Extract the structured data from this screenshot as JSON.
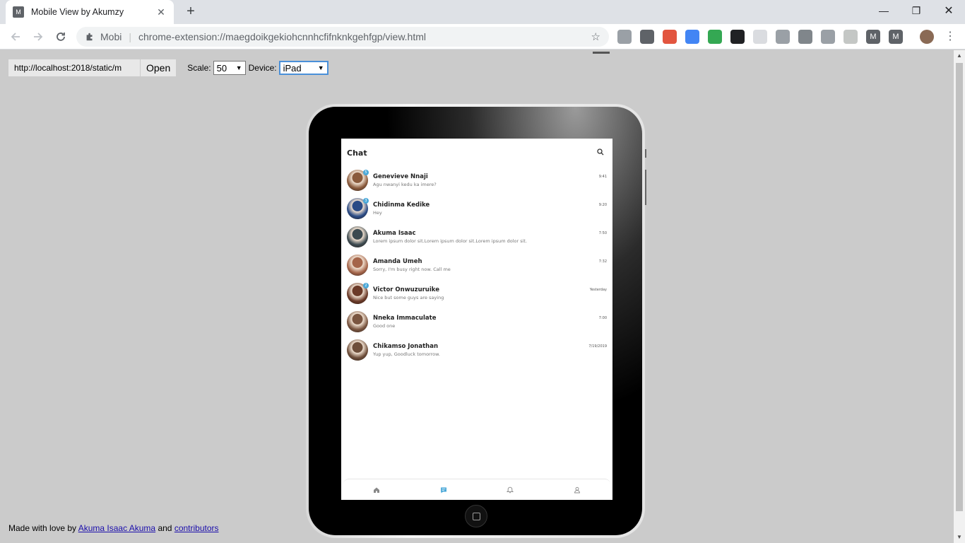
{
  "browser": {
    "tab_title": "Mobile View by Akumzy",
    "tab_favicon_letter": "M",
    "omnibox_ext_label": "Mobi",
    "url": "chrome-extension://maegdoikgekiohcnnhcfifnknkgehfgp/view.html",
    "extension_icons": [
      "shield-icon",
      "lock-icon",
      "colorful-icon",
      "translate-icon",
      "download-icon",
      "pip-icon",
      "grid-icon",
      "compass-icon",
      "vuejs-icon",
      "camera-icon",
      "leaf-icon",
      "m-icon",
      "m-icon"
    ],
    "extension_letters": [
      "",
      "",
      "",
      "",
      "",
      "",
      "",
      "",
      "",
      "",
      "",
      "M",
      "M"
    ]
  },
  "controls": {
    "url_value": "http://localhost:2018/static/m",
    "open_label": "Open",
    "scale_label": "Scale:",
    "scale_value": "50",
    "device_label": "Device:",
    "device_value": "iPad"
  },
  "footer": {
    "prefix": "Made with love by",
    "author_link": "Akuma Isaac Akuma",
    "and": "and",
    "contributors_link": "contributors"
  },
  "app": {
    "header_title": "Chat",
    "chats": [
      {
        "name": "Genevieve Nnaji",
        "message": "Agu nwanyi kedu ka imere?",
        "time": "9:41",
        "badge": "5",
        "avatar_color": "#8a5a3c"
      },
      {
        "name": "Chidinma Kedike",
        "message": "Hey",
        "time": "9:20",
        "badge": "3",
        "avatar_color": "#2a4b86"
      },
      {
        "name": "Akuma Isaac",
        "message": "Lorem ipsum dolor sit.Lorem ipsum dolor sit.Lorem ipsum dolor sit.",
        "time": "7:50",
        "badge": "",
        "avatar_color": "#3c4a50"
      },
      {
        "name": "Amanda Umeh",
        "message": "Sorry, I'm busy right now. Call me",
        "time": "7:32",
        "badge": "",
        "avatar_color": "#a5654a"
      },
      {
        "name": "Victor Onwuzuruike",
        "message": "Nice but some guys are saying",
        "time": "Yesterday",
        "badge": "2",
        "avatar_color": "#6b3a28"
      },
      {
        "name": "Nneka Immaculate",
        "message": "Good one",
        "time": "7:00",
        "badge": "",
        "avatar_color": "#7a5540"
      },
      {
        "name": "Chikamso Jonathan",
        "message": "Yup yup, Goodluck tomorrow.",
        "time": "7/19/2019",
        "badge": "",
        "avatar_color": "#6e4e3a"
      }
    ],
    "nav": [
      "home-icon",
      "chat-icon",
      "bell-icon",
      "user-icon"
    ],
    "accent_color": "#4aa8d8"
  }
}
